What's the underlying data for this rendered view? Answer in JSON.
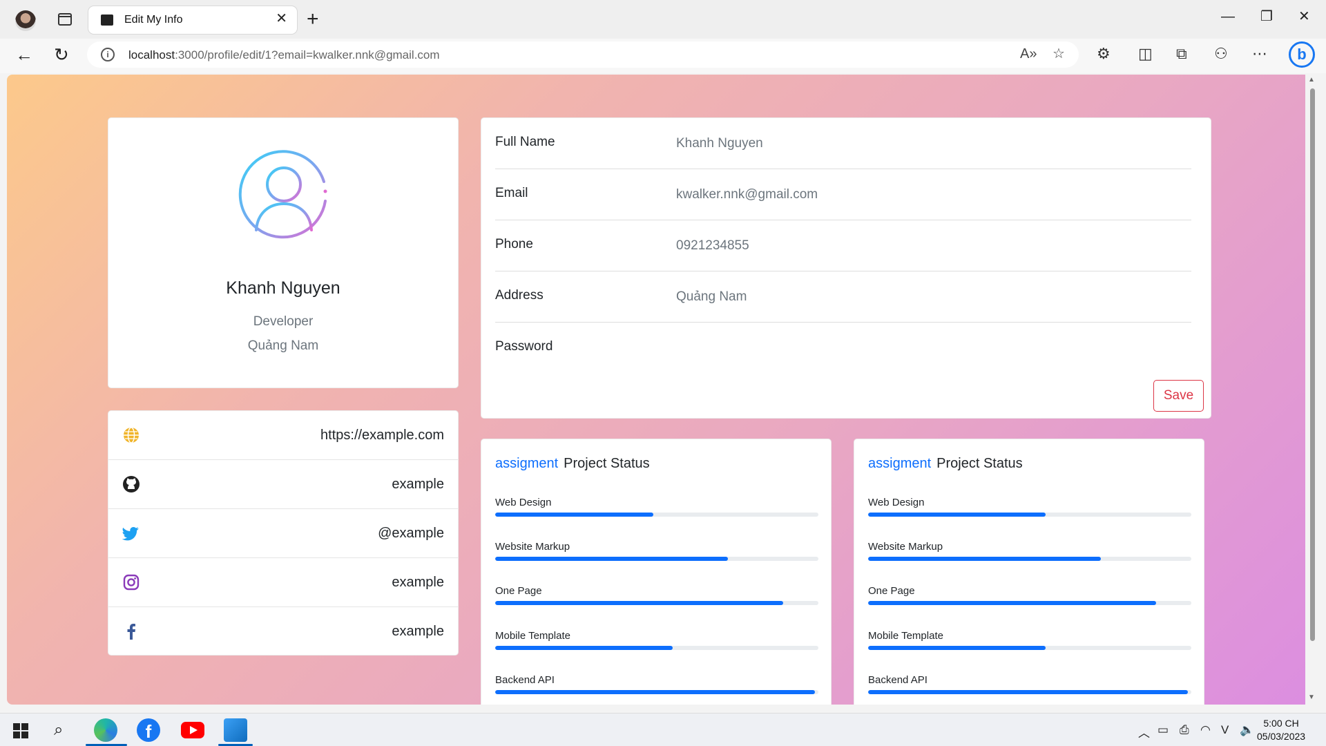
{
  "browser": {
    "tab_title": "Edit My Info",
    "url_host": "localhost",
    "url_rest": ":3000/profile/edit/1?email=kwalker.nnk@gmail.com"
  },
  "profile": {
    "name": "Khanh Nguyen",
    "role": "Developer",
    "location": "Quảng Nam"
  },
  "social": [
    {
      "icon": "globe-icon",
      "value": "https://example.com",
      "color": "#f0b429"
    },
    {
      "icon": "github-icon",
      "value": "example",
      "color": "#222222"
    },
    {
      "icon": "twitter-icon",
      "value": "@example",
      "color": "#1da1f2"
    },
    {
      "icon": "instagram-icon",
      "value": "example",
      "color": "#8a3ab9"
    },
    {
      "icon": "facebook-icon",
      "value": "example",
      "color": "#3b5998"
    }
  ],
  "info": {
    "rows": [
      {
        "label": "Full Name",
        "value": "Khanh Nguyen"
      },
      {
        "label": "Email",
        "value": "kwalker.nnk@gmail.com"
      },
      {
        "label": "Phone",
        "value": "0921234855"
      },
      {
        "label": "Address",
        "value": "Quảng Nam"
      },
      {
        "label": "Password",
        "value": ""
      }
    ],
    "save_label": "Save"
  },
  "projects": [
    {
      "tag": "assigment",
      "title": "Project Status",
      "items": [
        {
          "label": "Web Design",
          "percent": 49
        },
        {
          "label": "Website Markup",
          "percent": 72
        },
        {
          "label": "One Page",
          "percent": 89
        },
        {
          "label": "Mobile Template",
          "percent": 55
        },
        {
          "label": "Backend API",
          "percent": 99
        }
      ]
    },
    {
      "tag": "assigment",
      "title": "Project Status",
      "items": [
        {
          "label": "Web Design",
          "percent": 55
        },
        {
          "label": "Website Markup",
          "percent": 72
        },
        {
          "label": "One Page",
          "percent": 89
        },
        {
          "label": "Mobile Template",
          "percent": 55
        },
        {
          "label": "Backend API",
          "percent": 99
        }
      ]
    }
  ],
  "taskbar": {
    "time": "5:00 CH",
    "date": "05/03/2023"
  },
  "colors": {
    "accent": "#0d6efd",
    "danger": "#dc3545"
  }
}
